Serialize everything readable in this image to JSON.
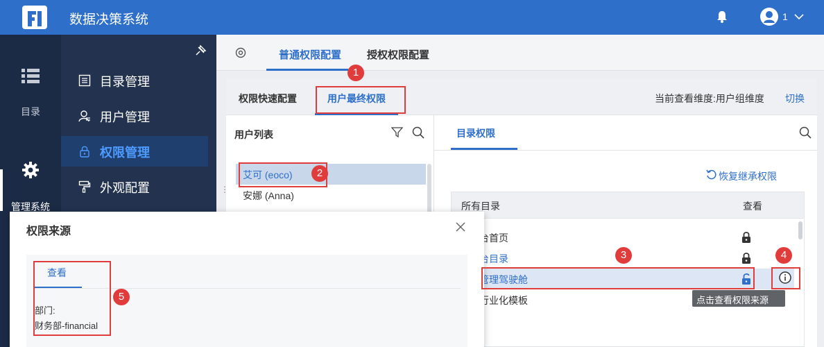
{
  "app": {
    "title": "数据决策系统",
    "user_name": "1"
  },
  "iconbar": {
    "directory_label": "目录",
    "management_label": "管理系统"
  },
  "menu": {
    "items": [
      {
        "label": "目录管理"
      },
      {
        "label": "用户管理"
      },
      {
        "label": "权限管理"
      },
      {
        "label": "外观配置"
      }
    ]
  },
  "tabs": {
    "normal": "普通权限配置",
    "grant": "授权权限配置"
  },
  "subtabs": {
    "quick": "权限快速配置",
    "final": "用户最终权限"
  },
  "dimension": {
    "text": "当前查看维度:用户组维度",
    "switch": "切换"
  },
  "user_list": {
    "title": "用户列表",
    "users": [
      "艾可 (eoco)",
      "安娜 (Anna)"
    ]
  },
  "dir_perm": {
    "tab": "目录权限",
    "restore": "恢复继承权限",
    "col_all": "所有目录",
    "col_view": "查看",
    "rows": [
      "台首页",
      "台目录",
      "管理驾驶舱",
      "行业化模板"
    ]
  },
  "tooltip": "点击查看权限来源",
  "modal": {
    "title": "权限来源",
    "tab": "查看",
    "dept_label": "部门:",
    "dept_value": "财务部-financial"
  },
  "badges": [
    "1",
    "2",
    "3",
    "4",
    "5"
  ],
  "colors": {
    "primary": "#2e6fc9",
    "annotation": "#e03c3c",
    "sidebar": "#1b2a45"
  }
}
